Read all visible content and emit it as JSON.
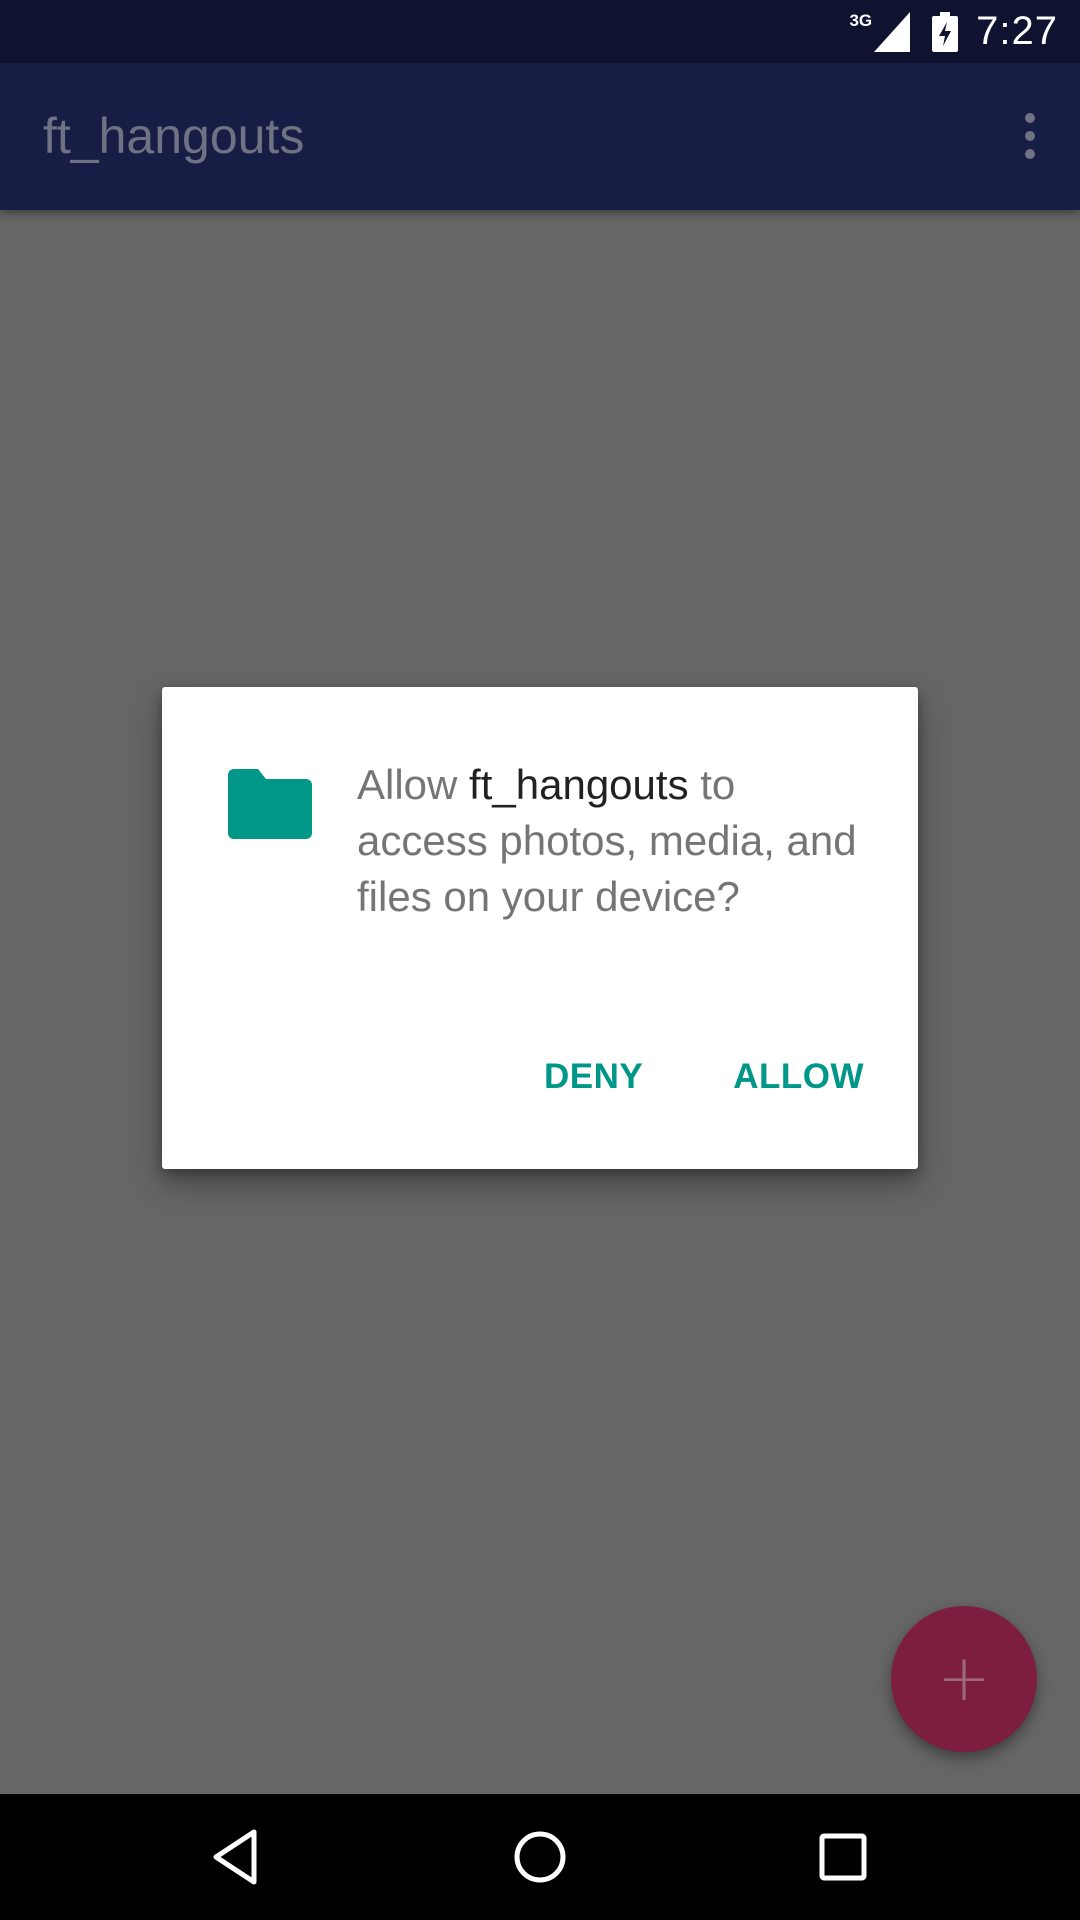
{
  "status_bar": {
    "network_type": "3G",
    "time": "7:27"
  },
  "app_bar": {
    "title": "ft_hangouts"
  },
  "dialog": {
    "message_prefix": "Allow ",
    "app_name": "ft_hangouts",
    "message_suffix": " to access photos, media, and files on your device?",
    "icon": "folder-icon",
    "deny_label": "DENY",
    "allow_label": "ALLOW",
    "accent_color": "#009688"
  },
  "fab": {
    "icon": "plus-icon",
    "symbol": "+",
    "color": "#7d1d3f"
  },
  "nav_bar": {
    "back_icon": "back-icon",
    "home_icon": "home-icon",
    "recents_icon": "recents-icon"
  },
  "colors": {
    "status_bar": "#0f1330",
    "app_bar": "#181d45",
    "scrim_background": "#666666"
  }
}
